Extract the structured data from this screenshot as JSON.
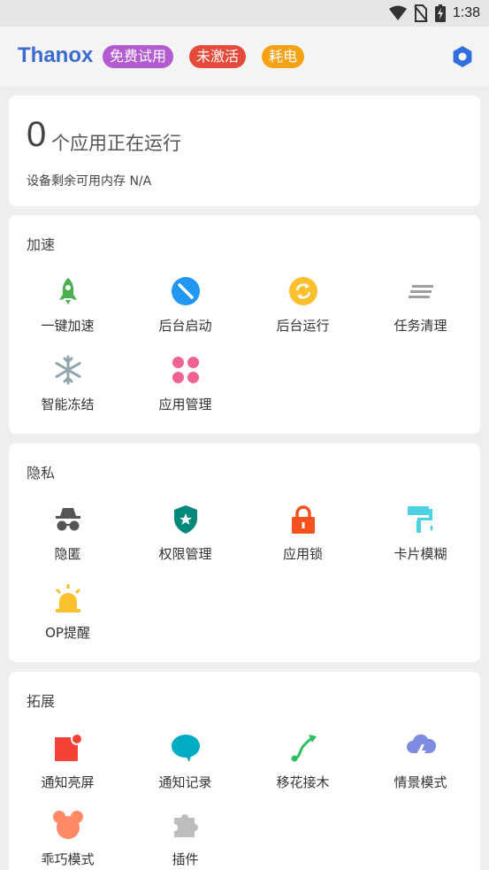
{
  "status_bar": {
    "time": "1:38",
    "icons": [
      "wifi-icon",
      "no-sim-icon",
      "battery-charging-icon"
    ]
  },
  "app_bar": {
    "title": "Thanox",
    "badges": [
      {
        "label": "免费试用",
        "color": "#b35bd0"
      },
      {
        "label": "未激活",
        "color": "#e64a3b"
      },
      {
        "label": "耗电",
        "color": "#f5a214"
      }
    ],
    "settings_icon": "hexagon-settings-icon"
  },
  "status_card": {
    "running_count": "0",
    "running_label": "个应用正在运行",
    "memory_text": "设备剩余可用内存 N/A"
  },
  "sections": [
    {
      "title": "加速",
      "items": [
        {
          "label": "一键加速",
          "icon": "rocket-icon",
          "color": "#4caf50"
        },
        {
          "label": "后台启动",
          "icon": "block-circle-icon",
          "color": "#2196f3"
        },
        {
          "label": "后台运行",
          "icon": "sync-circle-icon",
          "color": "#fbc02d"
        },
        {
          "label": "任务清理",
          "icon": "clear-list-icon",
          "color": "#9e9e9e"
        },
        {
          "label": "智能冻结",
          "icon": "snowflake-icon",
          "color": "#90a4ae"
        },
        {
          "label": "应用管理",
          "icon": "apps-grid-icon",
          "color": "#f06292"
        }
      ]
    },
    {
      "title": "隐私",
      "items": [
        {
          "label": "隐匿",
          "icon": "incognito-icon",
          "color": "#555555"
        },
        {
          "label": "权限管理",
          "icon": "shield-star-icon",
          "color": "#00897b"
        },
        {
          "label": "应用锁",
          "icon": "lock-icon",
          "color": "#f4511e"
        },
        {
          "label": "卡片模糊",
          "icon": "paint-roller-icon",
          "color": "#4dd0e1"
        },
        {
          "label": "OP提醒",
          "icon": "alarm-light-icon",
          "color": "#fbc02d"
        }
      ]
    },
    {
      "title": "拓展",
      "items": [
        {
          "label": "通知亮屏",
          "icon": "notification-screen-icon",
          "color": "#f44336"
        },
        {
          "label": "通知记录",
          "icon": "chat-bubble-icon",
          "color": "#00acc1"
        },
        {
          "label": "移花接木",
          "icon": "route-arrow-icon",
          "color": "#2bbf5f"
        },
        {
          "label": "情景模式",
          "icon": "weather-lightning-icon",
          "color": "#7e8ce0"
        },
        {
          "label": "乖巧模式",
          "icon": "mouse-ears-icon",
          "color": "#ff8a65"
        },
        {
          "label": "插件",
          "icon": "puzzle-icon",
          "color": "#bdbdbd"
        }
      ]
    }
  ]
}
